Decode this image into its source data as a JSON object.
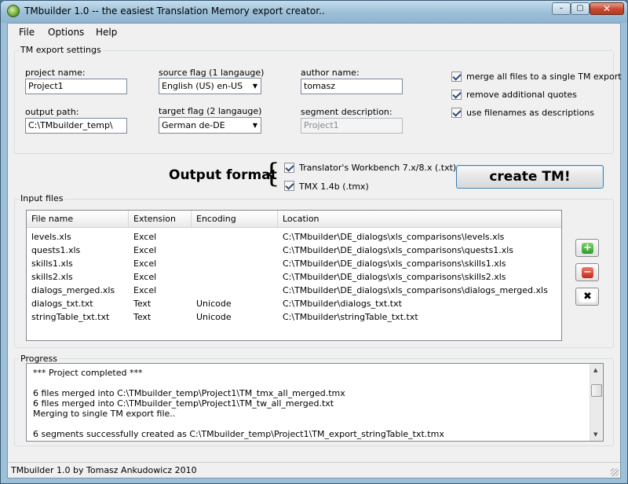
{
  "window": {
    "title": "TMbuilder 1.0 -- the easiest Translation Memory export creator..",
    "controls": {
      "minimize": "–",
      "maximize": "▢",
      "close": "✕"
    }
  },
  "menu": [
    "File",
    "Options",
    "Help"
  ],
  "settings": {
    "legend": "TM export settings",
    "project_name": {
      "label": "project name:",
      "value": "Project1"
    },
    "output_path": {
      "label": "output path:",
      "value": "C:\\TMbuilder_temp\\"
    },
    "source_flag": {
      "label": "source flag (1 langauge)",
      "value": "English (US) en-US"
    },
    "target_flag": {
      "label": "target flag (2 langauge)",
      "value": "German de-DE"
    },
    "author_name": {
      "label": "author name:",
      "value": "tomasz"
    },
    "segment_description": {
      "label": "segment description:",
      "value": "Project1"
    },
    "options": [
      {
        "label": "merge all files to a single TM export",
        "checked": true
      },
      {
        "label": "remove additional quotes",
        "checked": true
      },
      {
        "label": "use filenames as descriptions",
        "checked": true
      }
    ]
  },
  "output": {
    "title": "Output format",
    "brace": "{",
    "formats": [
      {
        "label": "Translator's Workbench 7.x/8.x (.txt)",
        "checked": true
      },
      {
        "label": "TMX 1.4b (.tmx)",
        "checked": true
      }
    ],
    "create_label": "create TM!"
  },
  "input_files": {
    "legend": "Input files",
    "columns": [
      "File name",
      "Extension",
      "Encoding",
      "Location"
    ],
    "rows": [
      {
        "file": "levels.xls",
        "ext": "Excel",
        "enc": "",
        "loc": "C:\\TMbuilder\\DE_dialogs\\xls_comparisons\\levels.xls"
      },
      {
        "file": "quests1.xls",
        "ext": "Excel",
        "enc": "",
        "loc": "C:\\TMbuilder\\DE_dialogs\\xls_comparisons\\quests1.xls"
      },
      {
        "file": "skills1.xls",
        "ext": "Excel",
        "enc": "",
        "loc": "C:\\TMbuilder\\DE_dialogs\\xls_comparisons\\skills1.xls"
      },
      {
        "file": "skills2.xls",
        "ext": "Excel",
        "enc": "",
        "loc": "C:\\TMbuilder\\DE_dialogs\\xls_comparisons\\skills2.xls"
      },
      {
        "file": "dialogs_merged.xls",
        "ext": "Excel",
        "enc": "",
        "loc": "C:\\TMbuilder\\DE_dialogs\\xls_comparisons\\dialogs_merged.xls"
      },
      {
        "file": "dialogs_txt.txt",
        "ext": "Text",
        "enc": "Unicode",
        "loc": "C:\\TMbuilder\\dialogs_txt.txt"
      },
      {
        "file": "stringTable_txt.txt",
        "ext": "Text",
        "enc": "Unicode",
        "loc": "C:\\TMbuilder\\stringTable_txt.txt"
      }
    ],
    "buttons": [
      {
        "icon": "add-icon",
        "glyph": "+"
      },
      {
        "icon": "remove-icon",
        "glyph": "−"
      },
      {
        "icon": "clear-backspace-icon",
        "glyph": "✖"
      }
    ]
  },
  "progress": {
    "legend": "Progress",
    "lines": [
      "*** Project completed ***",
      "",
      "6 files merged into C:\\TMbuilder_temp\\Project1\\TM_tmx_all_merged.tmx",
      "6 files merged into C:\\TMbuilder_temp\\Project1\\TM_tw_all_merged.txt",
      "Merging to single TM export file..",
      "",
      "6 segments successfully created as C:\\TMbuilder_temp\\Project1\\TM_export_stringTable_txt.tmx"
    ]
  },
  "status": "TMbuilder 1.0 by Tomasz Ankudowicz 2010"
}
